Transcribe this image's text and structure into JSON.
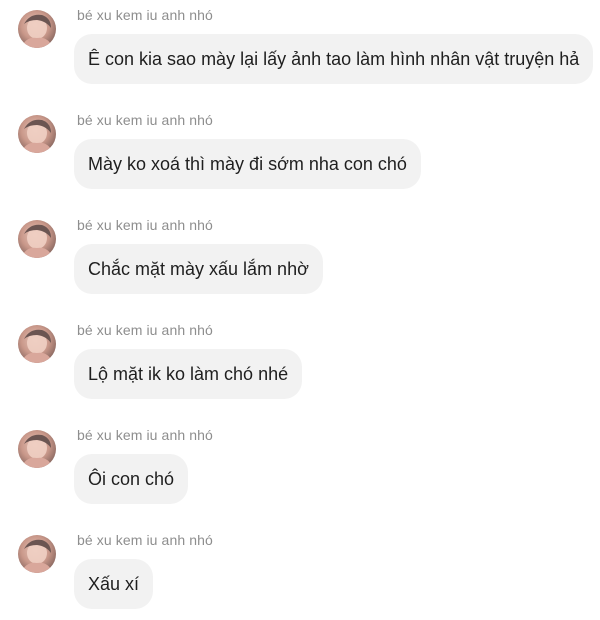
{
  "conversation": {
    "messages": [
      {
        "sender": "bé xu kem iu anh nhó",
        "text": "Ê con kia sao mày lại lấy ảnh tao làm hình nhân vật truyện hả"
      },
      {
        "sender": "bé xu kem iu anh nhó",
        "text": "Mày ko xoá thì mày đi sớm nha con chó"
      },
      {
        "sender": "bé xu kem iu anh nhó",
        "text": "Chắc mặt mày xấu lắm nhờ"
      },
      {
        "sender": "bé xu kem iu anh nhó",
        "text": "Lộ mặt ik ko làm chó nhé"
      },
      {
        "sender": "bé xu kem iu anh nhó",
        "text": "Ôi con chó"
      },
      {
        "sender": "bé xu kem iu anh nhó",
        "text": "Xấu xí"
      }
    ]
  },
  "colors": {
    "background": "#ffffff",
    "bubble": "#f2f2f2",
    "sender_text": "#8e8e8e",
    "message_text": "#1f1f1f"
  }
}
